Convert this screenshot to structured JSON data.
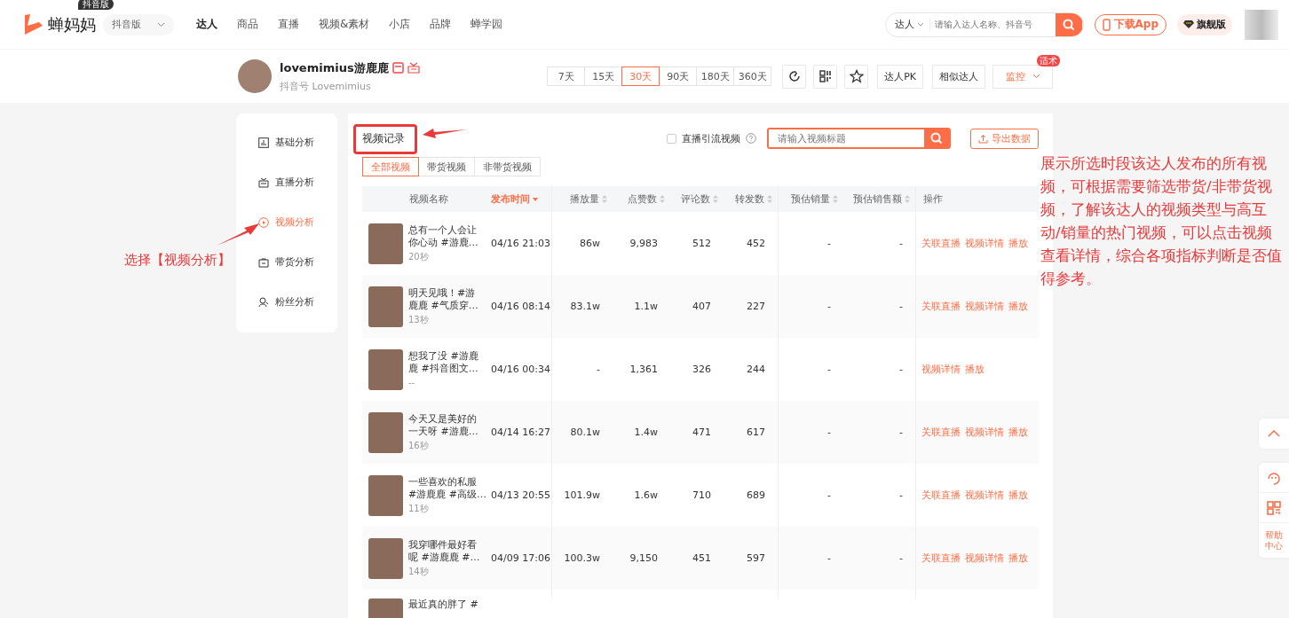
{
  "header": {
    "logo_text": "蝉妈妈",
    "edition_badge": "抖音版",
    "platform_select": "抖音版",
    "nav": [
      {
        "label": "达人",
        "selected": true
      },
      {
        "label": "商品",
        "selected": false
      },
      {
        "label": "直播",
        "selected": false
      },
      {
        "label": "视频&素材",
        "selected": false
      },
      {
        "label": "小店",
        "selected": false
      },
      {
        "label": "品牌",
        "selected": false
      },
      {
        "label": "蝉学园",
        "selected": false
      }
    ],
    "search": {
      "scope": "达人",
      "placeholder": "请输入达人名称、抖音号"
    },
    "download_button": "下载App",
    "flagship_button": "旗舰版"
  },
  "profile": {
    "name": "lovemimius游鹿鹿",
    "account": "抖音号 Lovemimius",
    "ranges": [
      {
        "label": "7天",
        "selected": false
      },
      {
        "label": "15天",
        "selected": false
      },
      {
        "label": "30天",
        "selected": true
      },
      {
        "label": "90天",
        "selected": false
      },
      {
        "label": "180天",
        "selected": false
      },
      {
        "label": "360天",
        "selected": false
      }
    ],
    "pk_button": "达人PK",
    "similar_button": "相似达人",
    "monitor_button": "监控",
    "monitor_badge": "适术"
  },
  "sidebar": {
    "items": [
      {
        "label": "基础分析",
        "selected": false
      },
      {
        "label": "直播分析",
        "selected": false
      },
      {
        "label": "视频分析",
        "selected": true
      },
      {
        "label": "带货分析",
        "selected": false
      },
      {
        "label": "粉丝分析",
        "selected": false
      }
    ]
  },
  "video_panel": {
    "title": "视频记录",
    "live_filter": {
      "label": "直播引流视频",
      "checked": false
    },
    "search_placeholder": "请输入视频标题",
    "export_button": "导出数据",
    "filters": [
      {
        "label": "全部视频",
        "selected": true
      },
      {
        "label": "带货视频",
        "selected": false
      },
      {
        "label": "非带货视频",
        "selected": false
      }
    ],
    "columns": [
      {
        "label": "视频名称",
        "sortable": false,
        "sorted": false
      },
      {
        "label": "发布时间",
        "sortable": true,
        "sorted": true
      },
      {
        "label": "播放量",
        "sortable": true,
        "sorted": false
      },
      {
        "label": "点赞数",
        "sortable": true,
        "sorted": false
      },
      {
        "label": "评论数",
        "sortable": true,
        "sorted": false
      },
      {
        "label": "转发数",
        "sortable": true,
        "sorted": false
      },
      {
        "label": "预估销量",
        "sortable": true,
        "sorted": false
      },
      {
        "label": "预估销售额",
        "sortable": true,
        "sorted": false
      },
      {
        "label": "操作",
        "sortable": false,
        "sorted": false
      }
    ],
    "rows": [
      {
        "title": [
          "总有一个人会让",
          "你心动 #游鹿…"
        ],
        "duration": "20秒",
        "time": "04/16 21:03",
        "plays": "86w",
        "likes": "9,983",
        "comments": "512",
        "shares": "452",
        "sales": "-",
        "revenue": "-",
        "actions": [
          "关联直播",
          "视频详情",
          "播放"
        ]
      },
      {
        "title": [
          "明天见哦！#游",
          "鹿鹿 #气质穿…"
        ],
        "duration": "13秒",
        "time": "04/16 08:14",
        "plays": "83.1w",
        "likes": "1.1w",
        "comments": "407",
        "shares": "227",
        "sales": "-",
        "revenue": "-",
        "actions": [
          "关联直播",
          "视频详情",
          "播放"
        ]
      },
      {
        "title": [
          "想我了没 #游鹿",
          "鹿 #抖音图文…"
        ],
        "duration": "--",
        "time": "04/16 00:34",
        "plays": "-",
        "likes": "1,361",
        "comments": "326",
        "shares": "244",
        "sales": "-",
        "revenue": "-",
        "actions": [
          "视频详情",
          "播放"
        ]
      },
      {
        "title": [
          "今天又是美好的",
          "一天呀 #游鹿…"
        ],
        "duration": "16秒",
        "time": "04/14 16:27",
        "plays": "80.1w",
        "likes": "1.4w",
        "comments": "471",
        "shares": "617",
        "sales": "-",
        "revenue": "-",
        "actions": [
          "关联直播",
          "视频详情",
          "播放"
        ]
      },
      {
        "title": [
          "一些喜欢的私服",
          "#游鹿鹿 #高级…"
        ],
        "duration": "11秒",
        "time": "04/13 20:55",
        "plays": "101.9w",
        "likes": "1.6w",
        "comments": "710",
        "shares": "689",
        "sales": "-",
        "revenue": "-",
        "actions": [
          "关联直播",
          "视频详情",
          "播放"
        ]
      },
      {
        "title": [
          "我穿哪件最好看",
          "呢 #游鹿鹿 #…"
        ],
        "duration": "14秒",
        "time": "04/09 17:06",
        "plays": "100.3w",
        "likes": "9,150",
        "comments": "451",
        "shares": "597",
        "sales": "-",
        "revenue": "-",
        "actions": [
          "关联直播",
          "视频详情",
          "播放"
        ]
      },
      {
        "title": [
          "最近真的胖了 #"
        ]
      }
    ]
  },
  "annotations": {
    "step_label": "选择【视频分析】",
    "explanation": "展示所选时段该达人发布的所有视频，可根据需要筛选带货/非带货视频，了解该达人的视频类型与高互动/销量的热门视频，可以点击视频查看详情，综合各项指标判断是否值得参考。"
  },
  "float_bar": {
    "help_label": "帮助中心"
  }
}
